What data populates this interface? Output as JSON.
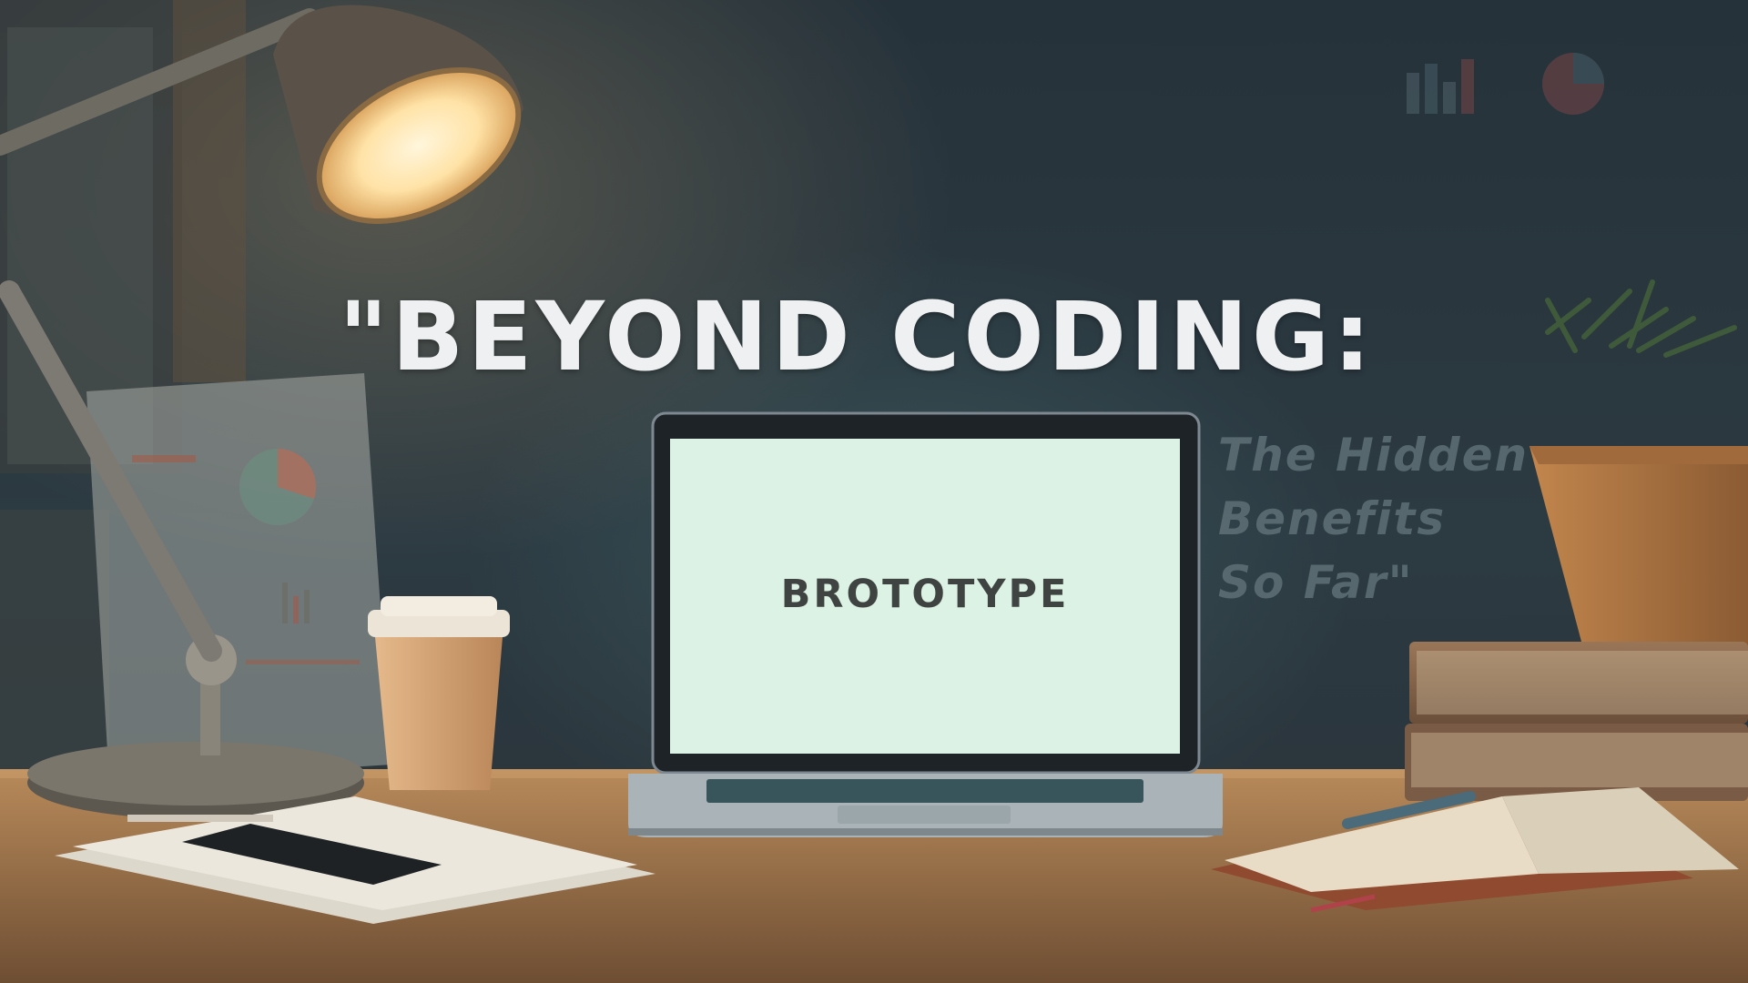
{
  "headline": {
    "text": "\"BEYOND CODING:"
  },
  "subtitle": {
    "lines": [
      "The Hidden",
      "Benefits",
      "So Far\""
    ]
  },
  "laptop": {
    "screen_text": "BROTOTYPE"
  },
  "colors": {
    "headline": "#eef0f1",
    "subtitle": "#5f7076",
    "screen": "#dcf2e4",
    "screen_text": "#3f4442",
    "lamp_light": "#fff2d2",
    "desk": "#b88a5a"
  }
}
